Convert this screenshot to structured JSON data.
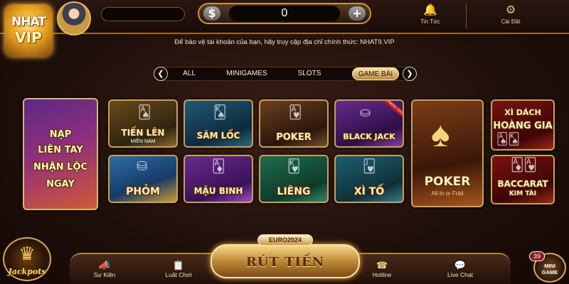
{
  "brand": {
    "logo_line1": "NHAT",
    "logo_line2": "VIP"
  },
  "balance": {
    "value": "0",
    "currency_symbol": "$",
    "add_symbol": "+"
  },
  "top_actions": {
    "news_label": "Tin Tức",
    "settings_label": "Cài Đặt"
  },
  "notice": "Để bảo vệ tài khoản của bạn, hãy truy cập địa chỉ chính thức: NHAT9.VIP",
  "tabs": {
    "items": [
      "ALL",
      "MINIGAMES",
      "SLOTS",
      "GAME BÀI"
    ],
    "active": "GAME BÀI"
  },
  "promo": {
    "line1": "NẠP",
    "line2": "LIÊN TAY",
    "line3": "NHẬN LỘC",
    "line4": "NGAY"
  },
  "games": {
    "tienlen": {
      "title": "TIẾN LÊN",
      "subtitle": "MIỀN NAM"
    },
    "samloc": {
      "title": "SÂM LỐC"
    },
    "poker": {
      "title": "POKER"
    },
    "blackjack": {
      "title": "BLACK JACK",
      "badge": "COMING SOON"
    },
    "phom": {
      "title": "PHỎM"
    },
    "maubinh": {
      "title": "MẬU BINH"
    },
    "lieng": {
      "title": "LIÊNG"
    },
    "xito": {
      "title": "XÌ TỐ"
    },
    "poker_featured": {
      "title": "POKER",
      "subtitle": "All-in or Fold"
    },
    "xidach": {
      "title": "XÌ DÁCH",
      "subtitle": "HOÀNG GIA"
    },
    "baccarat": {
      "title": "BACCARAT",
      "subtitle": "KIM TÀI"
    }
  },
  "bottom_nav": {
    "events": "Sự Kiện",
    "rules": "Luật Chơi",
    "hotline": "Hotline",
    "livechat": "Live Chat"
  },
  "withdraw": {
    "label": "RÚT TIỀN",
    "badge": "EURO2024"
  },
  "jackpot": {
    "label": "Jackpots"
  },
  "minigame": {
    "line1": "MINI",
    "line2": "GAME",
    "count": "39"
  },
  "colors": {
    "gold": "#c9a15a",
    "background": "#1f0f0a",
    "accent_red": "#c21717"
  }
}
